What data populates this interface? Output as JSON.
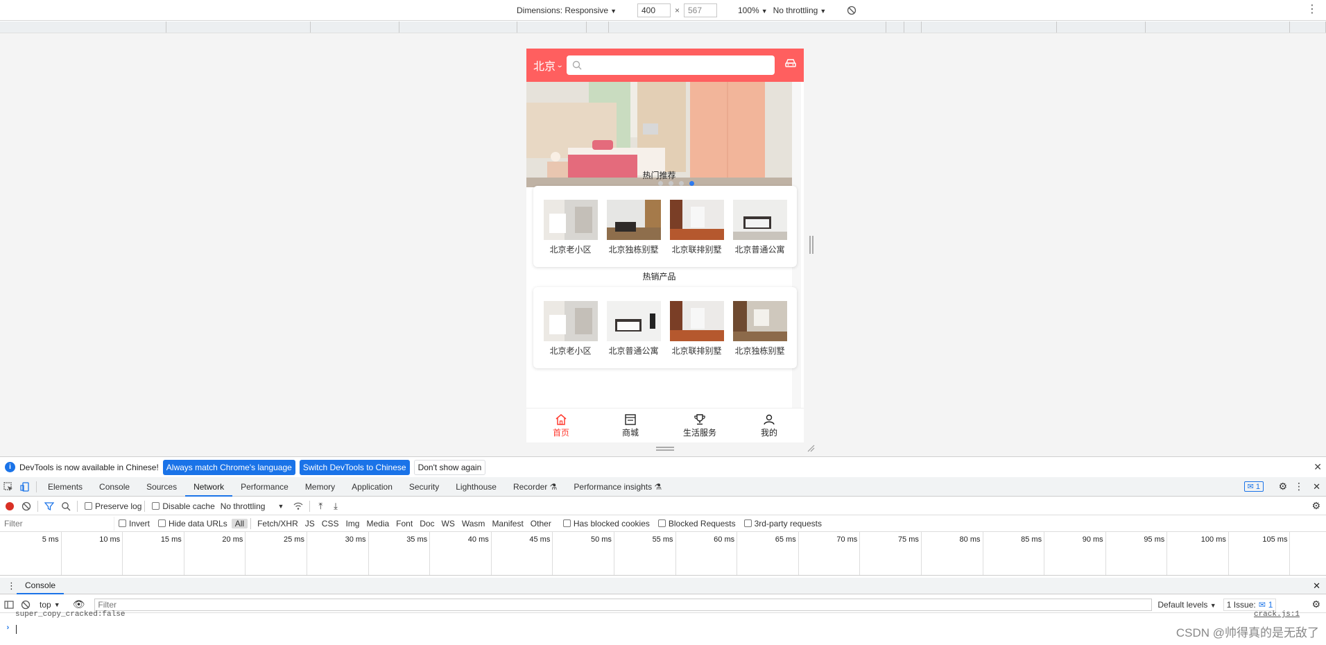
{
  "device_toolbar": {
    "dimensions_label": "Dimensions: Responsive",
    "width": "400",
    "height": "567",
    "zoom": "100%",
    "throttling": "No throttling"
  },
  "page": {
    "city": "北京",
    "search_placeholder": "",
    "banner_dots": 4,
    "banner_active_dot": 3,
    "section1_title": "热门推荐",
    "section1_items": [
      "北京老小区",
      "北京独栋别墅",
      "北京联排别墅",
      "北京普通公寓"
    ],
    "section2_title": "热销产品",
    "section2_items": [
      "北京老小区",
      "北京普通公寓",
      "北京联排别墅",
      "北京独栋别墅"
    ],
    "tabs": [
      "首页",
      "商城",
      "生活服务",
      "我的"
    ],
    "accent_color": "#ff5f5f"
  },
  "infobar": {
    "message": "DevTools is now available in Chinese!",
    "btn_match": "Always match Chrome's language",
    "btn_switch": "Switch DevTools to Chinese",
    "btn_dismiss": "Don't show again"
  },
  "devtools_tabs": [
    "Elements",
    "Console",
    "Sources",
    "Network",
    "Performance",
    "Memory",
    "Application",
    "Security",
    "Lighthouse",
    "Recorder",
    "Performance insights"
  ],
  "devtools_active_tab": "Network",
  "issues_badge": "1",
  "network_toolbar": {
    "preserve_log": "Preserve log",
    "disable_cache": "Disable cache",
    "throttling": "No throttling"
  },
  "filter_bar": {
    "filter_placeholder": "Filter",
    "invert": "Invert",
    "hide_data_urls": "Hide data URLs",
    "types": [
      "All",
      "Fetch/XHR",
      "JS",
      "CSS",
      "Img",
      "Media",
      "Font",
      "Doc",
      "WS",
      "Wasm",
      "Manifest",
      "Other"
    ],
    "has_blocked_cookies": "Has blocked cookies",
    "blocked_requests": "Blocked Requests",
    "third_party": "3rd-party requests"
  },
  "timeline_ticks": [
    "5 ms",
    "10 ms",
    "15 ms",
    "20 ms",
    "25 ms",
    "30 ms",
    "35 ms",
    "40 ms",
    "45 ms",
    "50 ms",
    "55 ms",
    "60 ms",
    "65 ms",
    "70 ms",
    "75 ms",
    "80 ms",
    "85 ms",
    "90 ms",
    "95 ms",
    "100 ms",
    "105 ms"
  ],
  "drawer": {
    "tab": "Console",
    "context": "top",
    "filter_placeholder": "Filter",
    "levels": "Default levels",
    "issues": "1 Issue:",
    "issues_count": "1",
    "log_line": "super_copy_cracked:false",
    "log_source": "crack.js:1",
    "watermark": "CSDN @帅得真的是无敌了"
  }
}
